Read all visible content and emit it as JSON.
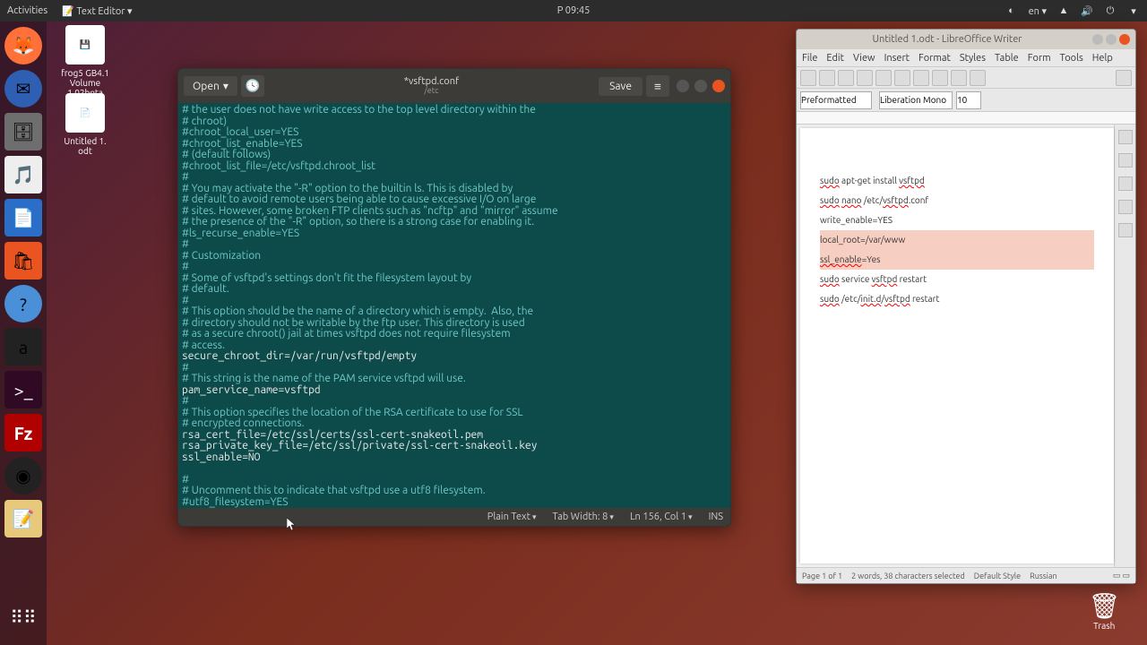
{
  "topbar": {
    "activities": "Activities",
    "app": "Text Editor",
    "clock": "P  09:45",
    "lang": "en"
  },
  "desktop": {
    "icon1_label": "frog5 GB4.1\nVolume\n1.02beta",
    "icon2_label": "Untitled 1.\nodt",
    "trash": "Trash"
  },
  "gedit": {
    "open": "Open",
    "title": "*vsftpd.conf",
    "subtitle": "/etc",
    "save": "Save",
    "content": "# the user does not have write access to the top level directory within the\n# chroot)\n#chroot_local_user=YES\n#chroot_list_enable=YES\n# (default follows)\n#chroot_list_file=/etc/vsftpd.chroot_list\n#\n# You may activate the \"-R\" option to the builtin ls. This is disabled by\n# default to avoid remote users being able to cause excessive I/O on large\n# sites. However, some broken FTP clients such as \"ncftp\" and \"mirror\" assume\n# the presence of the \"-R\" option, so there is a strong case for enabling it.\n#ls_recurse_enable=YES\n#\n# Customization\n#\n# Some of vsftpd's settings don't fit the filesystem layout by\n# default.\n#\n# This option should be the name of a directory which is empty.  Also, the\n# directory should not be writable by the ftp user. This directory is used\n# as a secure chroot() jail at times vsftpd does not require filesystem\n# access.\nsecure_chroot_dir=/var/run/vsftpd/empty\n#\n# This string is the name of the PAM service vsftpd will use.\npam_service_name=vsftpd\n#\n# This option specifies the location of the RSA certificate to use for SSL\n# encrypted connections.\nrsa_cert_file=/etc/ssl/certs/ssl-cert-snakeoil.pem\nrsa_private_key_file=/etc/ssl/private/ssl-cert-snakeoil.key\nssl_enable=NO\n\n#\n# Uncomment this to indicate that vsftpd use a utf8 filesystem.\n#utf8_filesystem=YES",
    "status": {
      "syntax": "Plain Text",
      "tab": "Tab Width: 8",
      "pos": "Ln 156, Col 1",
      "ins": "INS"
    }
  },
  "writer": {
    "title": "Untitled 1.odt - LibreOffice Writer",
    "menu": [
      "File",
      "Edit",
      "View",
      "Insert",
      "Format",
      "Styles",
      "Table",
      "Form",
      "Tools",
      "Help"
    ],
    "para_style": "Preformatted",
    "font_name": "Liberation Mono",
    "font_size": "10",
    "lines": [
      {
        "t": "sudo apt-get install vsftpd"
      },
      {
        "t": "sudo nano /etc/vsftpd.conf"
      },
      {
        "t": "write_enable=YES"
      },
      {
        "t": "local_root=/var/www",
        "hl": true
      },
      {
        "t": "ssl_enable=Yes",
        "hl": true
      },
      {
        "t": "sudo service vsftpd restart"
      },
      {
        "t": ""
      },
      {
        "t": "sudo /etc/init.d/vsftpd restart"
      }
    ],
    "status": {
      "page": "Page 1 of 1",
      "words": "2 words, 38 characters selected",
      "style": "Default Style",
      "lang": "Russian"
    }
  }
}
